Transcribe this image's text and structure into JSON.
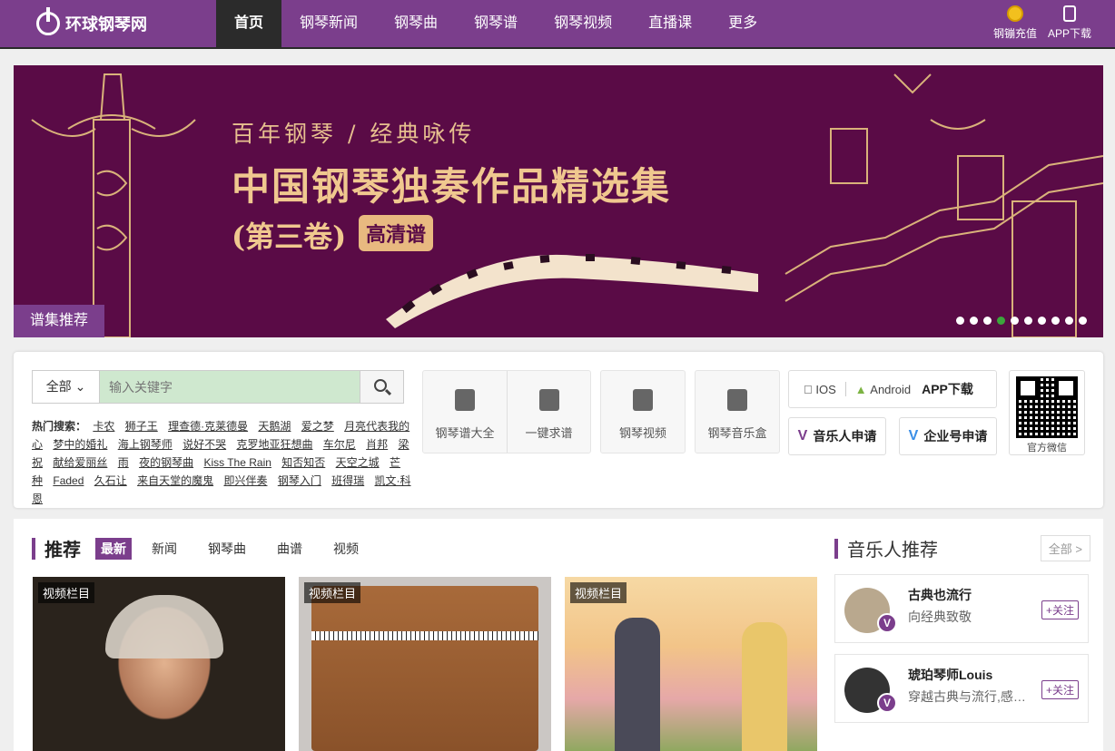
{
  "nav": {
    "logo": "环球钢琴网",
    "items": [
      {
        "label": "首页",
        "active": true
      },
      {
        "label": "钢琴新闻"
      },
      {
        "label": "钢琴曲"
      },
      {
        "label": "钢琴谱"
      },
      {
        "label": "钢琴视频"
      },
      {
        "label": "直播课"
      },
      {
        "label": "更多"
      }
    ],
    "recharge": "钢镚充值",
    "app": "APP下载"
  },
  "banner": {
    "subtitle": "百年钢琴 / 经典咏传",
    "title": "中国钢琴独奏作品精选集",
    "volume": "(第三卷)",
    "hd_badge": "高清谱",
    "tag": "谱集推荐",
    "dots_total": 10,
    "active_dot": 4
  },
  "search": {
    "scope": "全部",
    "placeholder": "输入关键字",
    "hot_label": "热门搜索：",
    "hot": [
      "卡农",
      "狮子王",
      "理查德·克莱德曼",
      "天鹅湖",
      "爱之梦",
      "月亮代表我的心",
      "梦中的婚礼",
      "海上钢琴师",
      "说好不哭",
      "克罗地亚狂想曲",
      "车尔尼",
      "肖邦",
      "梁祝",
      "献给爱丽丝",
      "雨",
      "夜的钢琴曲",
      "Kiss The Rain",
      "知否知否",
      "天空之城",
      "芒种",
      "Faded",
      "久石让",
      "来自天堂的魔鬼",
      "即兴伴奏",
      "钢琴入门",
      "班得瑞",
      "凯文·科恩"
    ]
  },
  "tools": {
    "group1": [
      "钢琴谱大全",
      "一键求谱"
    ],
    "video": "钢琴视频",
    "musicbox": "钢琴音乐盒"
  },
  "apps": {
    "ios": "IOS",
    "android": "Android",
    "download": "APP下载",
    "musician": "音乐人申请",
    "enterprise": "企业号申请",
    "wechat": "官方微信"
  },
  "recommend": {
    "title": "推荐",
    "tabs": [
      "最新",
      "新闻",
      "钢琴曲",
      "曲谱",
      "视频"
    ],
    "cards": [
      {
        "tag": "视频栏目"
      },
      {
        "tag": "视频栏目"
      },
      {
        "tag": "视频栏目"
      }
    ]
  },
  "musicians": {
    "title": "音乐人推荐",
    "all": "全部 >",
    "items": [
      {
        "name": "古典也流行",
        "desc": "向经典致敬",
        "follow": "+关注"
      },
      {
        "name": "琥珀琴师Louis",
        "desc": "穿越古典与流行,感受钢琴魅力",
        "follow": "+关注"
      }
    ]
  },
  "colors": {
    "brand": "#7b3e8c",
    "banner_bg": "#5a0b46",
    "gold": "#f0c88f"
  }
}
